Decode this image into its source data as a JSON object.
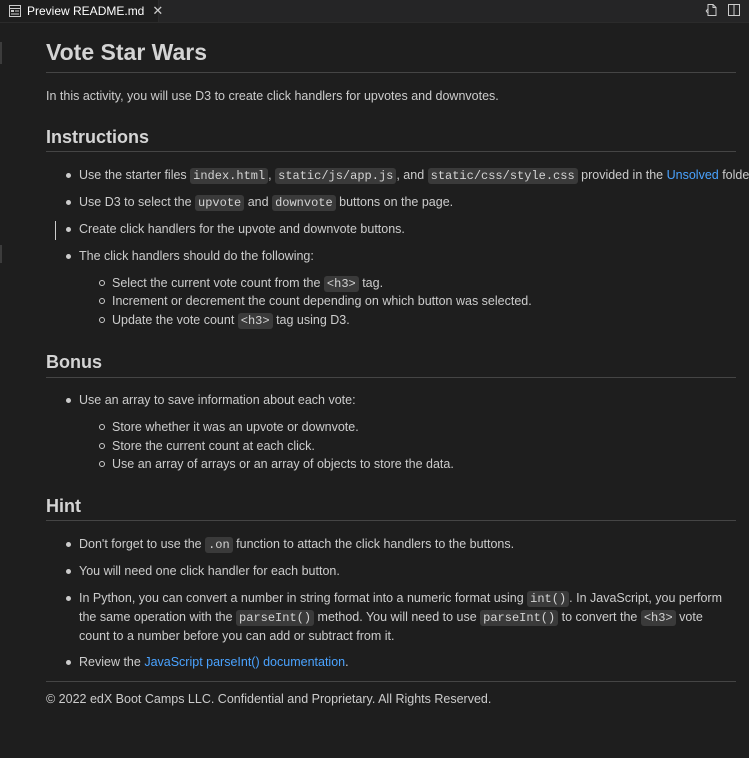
{
  "tab": {
    "label": "Preview README.md",
    "close": "✕"
  },
  "doc": {
    "title": "Vote Star Wars",
    "intro": "In this activity, you will use D3 to create click handlers for upvotes and downvotes.",
    "instructions": {
      "heading": "Instructions",
      "i1": {
        "t1": "Use the starter files ",
        "c1": "index.html",
        "t2": ", ",
        "c2": "static/js/app.js",
        "t3": ", and ",
        "c3": "static/css/style.css",
        "t4": " provided in the ",
        "link": "Unsolved",
        "t5": " folder."
      },
      "i2": {
        "t1": "Use D3 to select the ",
        "c1": "upvote",
        "t2": " and ",
        "c2": "downvote",
        "t3": " buttons on the page."
      },
      "i3": "Create click handlers for the upvote and downvote buttons.",
      "i4": "The click handlers should do the following:",
      "sub1": {
        "t1": "Select the current vote count from the ",
        "c1": "<h3>",
        "t2": " tag."
      },
      "sub2": "Increment or decrement the count depending on which button was selected.",
      "sub3": {
        "t1": "Update the vote count ",
        "c1": "<h3>",
        "t2": " tag using D3."
      }
    },
    "bonus": {
      "heading": "Bonus",
      "i1": "Use an array to save information about each vote:",
      "sub1": "Store whether it was an upvote or downvote.",
      "sub2": "Store the current count at each click.",
      "sub3": "Use an array of arrays or an array of objects to store the data."
    },
    "hint": {
      "heading": "Hint",
      "i1": {
        "t1": "Don't forget to use the ",
        "c1": ".on",
        "t2": " function to attach the click handlers to the buttons."
      },
      "i2": "You will need one click handler for each button.",
      "i3": {
        "t1": "In Python, you can convert a number in string format into a numeric format using ",
        "c1": "int()",
        "t2": ". In JavaScript, you perform the same operation with the ",
        "c2": "parseInt()",
        "t3": " method. You will need to use ",
        "c3": "parseInt()",
        "t4": " to convert the ",
        "c4": "<h3>",
        "t5": " vote count to a number before you can add or subtract from it."
      },
      "i4": {
        "t1": "Review the ",
        "link": "JavaScript parseInt() documentation",
        "t2": "."
      }
    },
    "footer": "© 2022 edX Boot Camps LLC. Confidential and Proprietary. All Rights Reserved."
  },
  "colors": {
    "background": "#1e1e1e",
    "text": "#cccccc",
    "link": "#4aa3ff",
    "code_bg": "#3a3a3a"
  },
  "icons": {
    "tab": "preview-icon",
    "actions": [
      "open-source-icon",
      "split-editor-icon"
    ]
  }
}
